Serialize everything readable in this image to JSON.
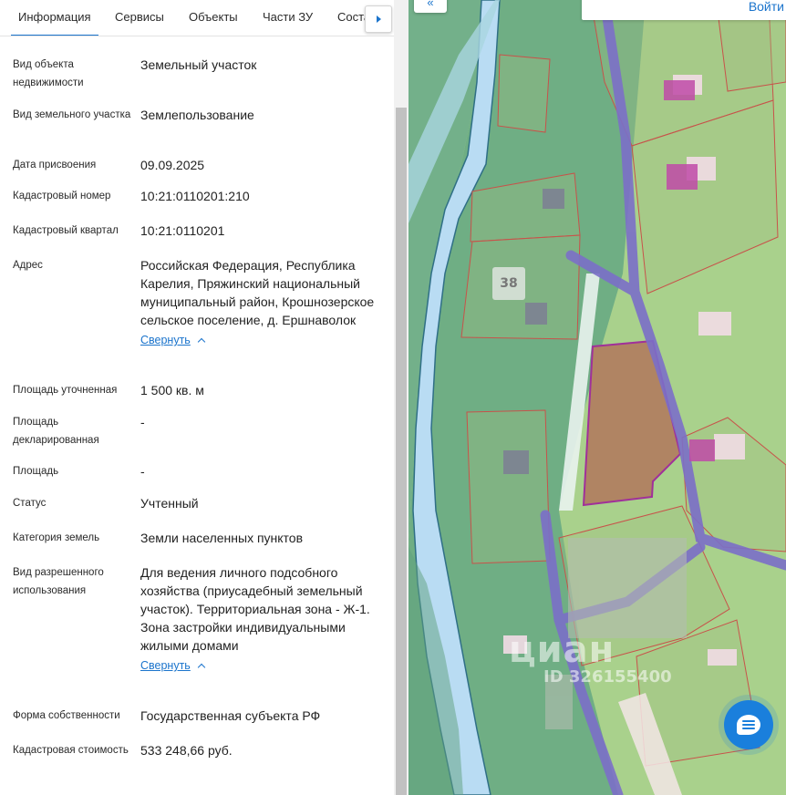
{
  "tabs": [
    {
      "label": "Информация",
      "active": true
    },
    {
      "label": "Сервисы"
    },
    {
      "label": "Объекты"
    },
    {
      "label": "Части ЗУ"
    },
    {
      "label": "Состав"
    }
  ],
  "fields": [
    {
      "label": "Вид объекта недвижимости",
      "value": "Земельный участок"
    },
    {
      "label": "Вид земельного участка",
      "value": "Землепользование"
    },
    {
      "label": "Дата присвоения",
      "value": "09.09.2025"
    },
    {
      "label": "Кадастровый номер",
      "value": "10:21:0110201:210"
    },
    {
      "label": "Кадастровый квартал",
      "value": "10:21:0110201"
    },
    {
      "label": "Адрес",
      "value": "Российская Федерация, Республика Карелия, Пряжинский национальный муниципальный район, Крошнозерское сельское поселение, д. Ершнаволок",
      "collapse": "Свернуть"
    },
    {
      "label": "Площадь уточненная",
      "value": "1 500 кв. м"
    },
    {
      "label": "Площадь декларированная",
      "value": "-"
    },
    {
      "label": "Площадь",
      "value": "-"
    },
    {
      "label": "Статус",
      "value": "Учтенный"
    },
    {
      "label": "Категория земель",
      "value": "Земли населенных пунктов"
    },
    {
      "label": "Вид разрешенного использования",
      "value": "Для ведения личного подсобного хозяйства (приусадебный земельный участок). Территориальная зона - Ж-1. Зона застройки индивидуальными жилыми домами",
      "collapse": "Свернуть"
    },
    {
      "label": "Форма собственности",
      "value": "Государственная субъекта РФ"
    },
    {
      "label": "Кадастровая стоимость",
      "value": "533 248,66 руб."
    }
  ],
  "map": {
    "login_label": "Войти",
    "plot_label": "38",
    "watermark": "циан",
    "watermark_id": "ID 326155400",
    "colors": {
      "land": "#a7cf8d",
      "forest": "#6fae84",
      "water": "#b9dcf3",
      "road": "#7b6fc8",
      "highlight": "#b23aa0",
      "parcel_border": "#c8524a"
    }
  },
  "icons": {
    "tab_scroll": "chevron-right-icon",
    "map_collapse": "double-chevron-left-icon",
    "chat": "chat-bubble-icon"
  }
}
